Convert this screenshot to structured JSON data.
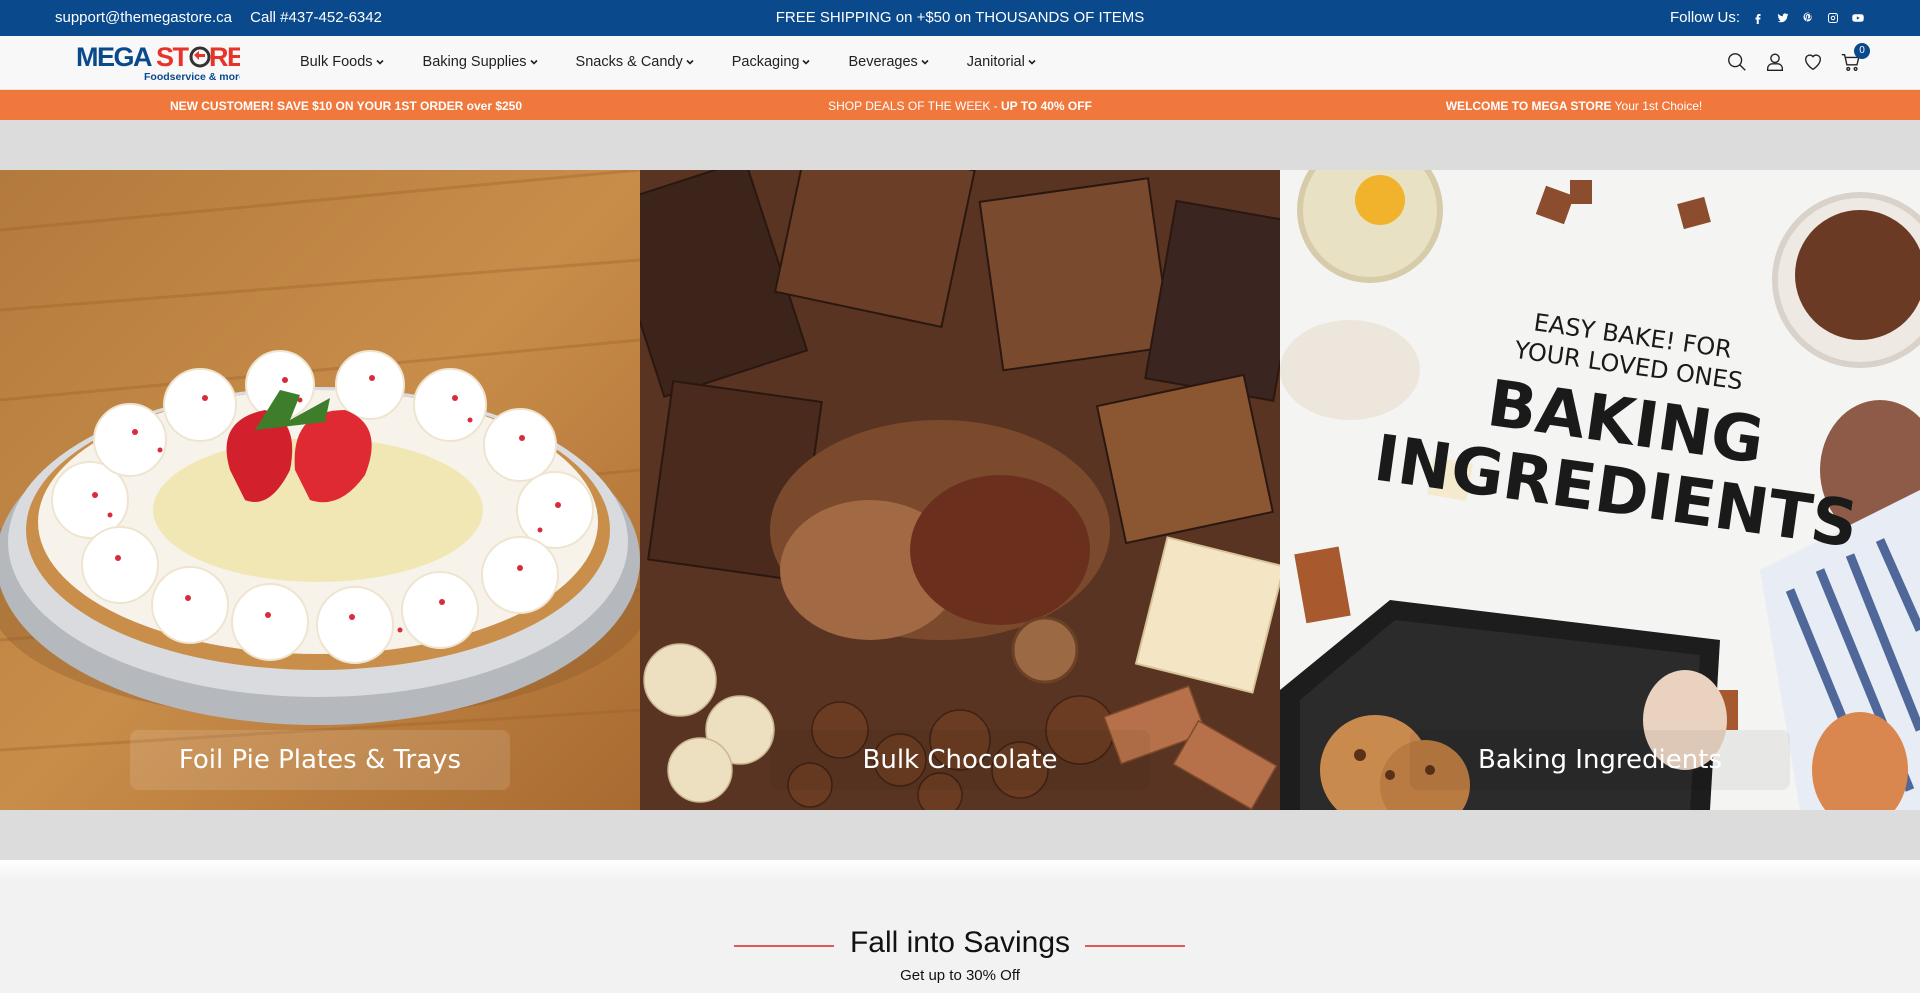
{
  "topbar": {
    "email": "support@themegastore.ca",
    "phone": "Call #437-452-6342",
    "promo": "FREE SHIPPING on +$50 on THOUSANDS OF ITEMS",
    "follow_label": "Follow Us:",
    "social": [
      "facebook-icon",
      "twitter-icon",
      "pinterest-icon",
      "instagram-icon",
      "youtube-icon"
    ]
  },
  "logo": {
    "brand": "MEGASTORE",
    "tagline": "Foodservice & more"
  },
  "nav": {
    "menu": [
      "Bulk Foods",
      "Baking Supplies",
      "Snacks & Candy",
      "Packaging",
      "Beverages",
      "Janitorial"
    ],
    "cart_count": "0"
  },
  "announcements": {
    "m1": "NEW CUSTOMER! SAVE $10 ON YOUR 1ST ORDER over $250",
    "m2_prefix": "SHOP DEALS OF THE WEEK - ",
    "m2_bold": "UP TO 40% OFF",
    "m3_bold": "WELCOME TO MEGA STORE",
    "m3_rest": " Your 1st Choice!"
  },
  "banners": [
    {
      "caption": "Foil Pie Plates & Trays"
    },
    {
      "caption": "Bulk Chocolate"
    },
    {
      "caption": "Baking Ingredients",
      "headline_small_1": "EASY BAKE! FOR",
      "headline_small_2": "YOUR LOVED ONES",
      "headline_big_1": "BAKING",
      "headline_big_2": "INGREDIENTS"
    }
  ],
  "savings": {
    "title": "Fall into Savings",
    "subtitle": "Get up to 30% Off"
  },
  "colors": {
    "topbar": "#0a4a8c",
    "announcement": "#f0783c",
    "accent_rule": "#e05a5a"
  }
}
